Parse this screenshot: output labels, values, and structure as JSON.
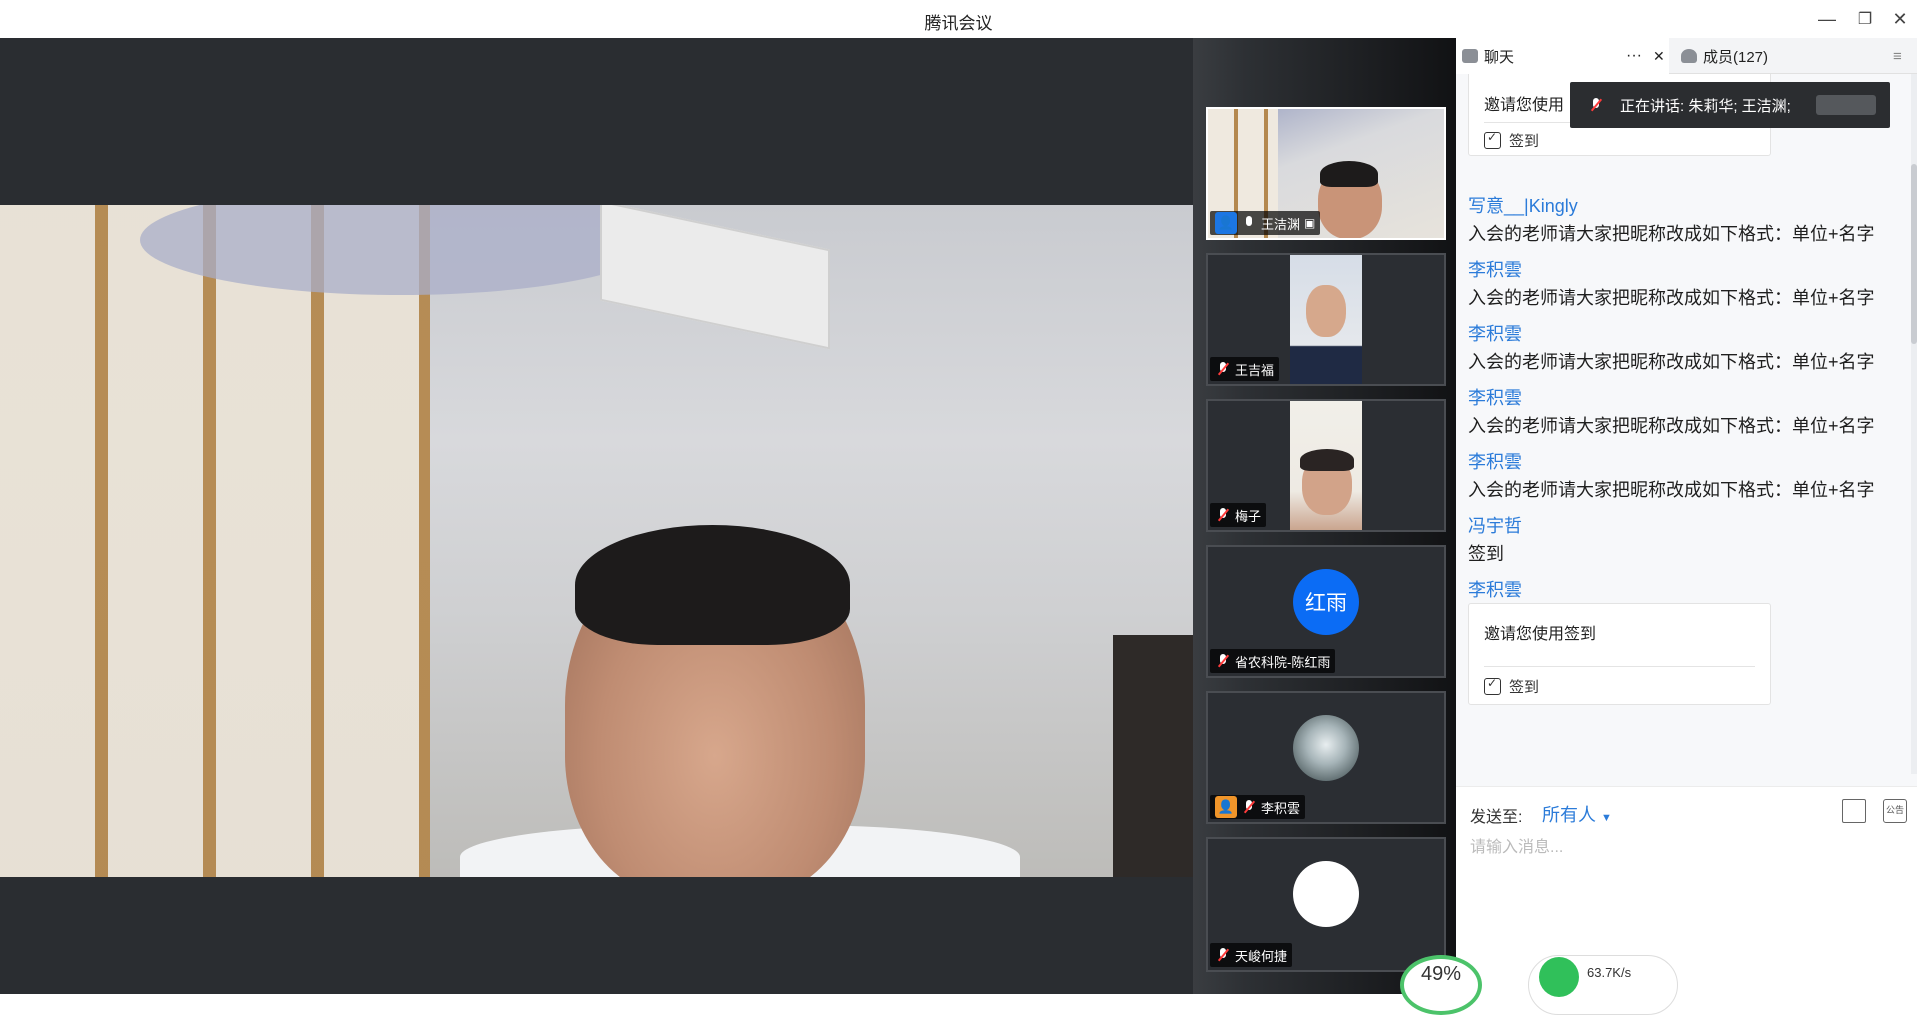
{
  "window": {
    "title": "腾讯会议"
  },
  "controls": {
    "minimize": "—",
    "restore": "❐",
    "close": "✕"
  },
  "gallery": [
    {
      "name": "王洁渊",
      "muted": false,
      "host": true,
      "avatar_text": ""
    },
    {
      "name": "王吉福",
      "muted": true,
      "host": false,
      "avatar_text": ""
    },
    {
      "name": "梅子",
      "muted": true,
      "host": false,
      "avatar_text": ""
    },
    {
      "name": "省农科院-陈红雨",
      "muted": true,
      "host": false,
      "avatar_text": "红雨"
    },
    {
      "name": "李积雲",
      "muted": true,
      "host": true,
      "avatar_text": ""
    },
    {
      "name": "天峻何捷",
      "muted": true,
      "host": false,
      "avatar_text": ""
    }
  ],
  "speaking": {
    "label": "正在讲话: 朱莉华; 王洁渊;"
  },
  "panel": {
    "tab_chat": "聊天",
    "tab_more": "···",
    "tab_close": "✕",
    "tab_members": "成员(127)",
    "menu": "≡"
  },
  "chat": {
    "top_card": {
      "text": "邀请您使用",
      "signin": "签到"
    },
    "messages": [
      {
        "sender": "写意__|Kingly",
        "text": "入会的老师请大家把昵称改成如下格式：单位+名字"
      },
      {
        "sender": "李积雲",
        "text": "入会的老师请大家把昵称改成如下格式：单位+名字"
      },
      {
        "sender": "李积雲",
        "text": "入会的老师请大家把昵称改成如下格式：单位+名字"
      },
      {
        "sender": "李积雲",
        "text": "入会的老师请大家把昵称改成如下格式：单位+名字"
      },
      {
        "sender": "李积雲",
        "text": "入会的老师请大家把昵称改成如下格式：单位+名字"
      },
      {
        "sender": "冯宇哲",
        "text": "签到"
      },
      {
        "sender": "李积雲",
        "text": ""
      }
    ],
    "bottom_card": {
      "text": "邀请您使用签到",
      "signin": "签到"
    }
  },
  "composer": {
    "send_to_label": "发送至:",
    "recipient": "所有人",
    "placeholder": "请输入消息...",
    "tool_public": "公告"
  },
  "stats": {
    "cpu": "49%",
    "network": "63.7K/s"
  },
  "colors": {
    "accent": "#2b7bd9",
    "host_blue": "#1c76e3",
    "avatar_blue": "#0b6cf5"
  }
}
